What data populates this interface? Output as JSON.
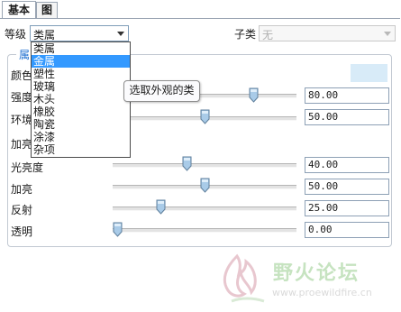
{
  "tabs": [
    {
      "label": "基本",
      "active": true
    },
    {
      "label": "图",
      "active": false
    }
  ],
  "level": {
    "label": "等级",
    "value": "类属"
  },
  "subclass": {
    "label": "子类",
    "value": "无",
    "disabled": true
  },
  "group": {
    "title": "属"
  },
  "dropdown": {
    "options": [
      "类属",
      "金属",
      "塑性",
      "玻璃",
      "木头",
      "橡胶",
      "陶瓷",
      "涂漆",
      "杂项"
    ],
    "selected_index": 1
  },
  "tooltip": "选取外观的类",
  "properties": [
    {
      "label": "颜色",
      "swatch_color": "#d8ebf8"
    },
    {
      "label": "强度",
      "value": "80.00",
      "level": 0.78
    },
    {
      "label": "环境",
      "value": "50.00",
      "level": 0.5
    },
    {
      "label": "加亮"
    },
    {
      "label": "光亮度",
      "value": "40.00",
      "level": 0.4
    },
    {
      "label": "加亮",
      "value": "50.00",
      "level": 0.5
    },
    {
      "label": "反射",
      "value": "25.00",
      "level": 0.25
    },
    {
      "label": "透明",
      "value": "0.00",
      "level": 0.0
    }
  ],
  "watermark": {
    "name": "野火论坛",
    "url": "www.proewildfire.cn"
  },
  "colors": {
    "accent": "#3399ff",
    "group_title": "#1e6fd0",
    "thumb": "#a9cbe8"
  }
}
